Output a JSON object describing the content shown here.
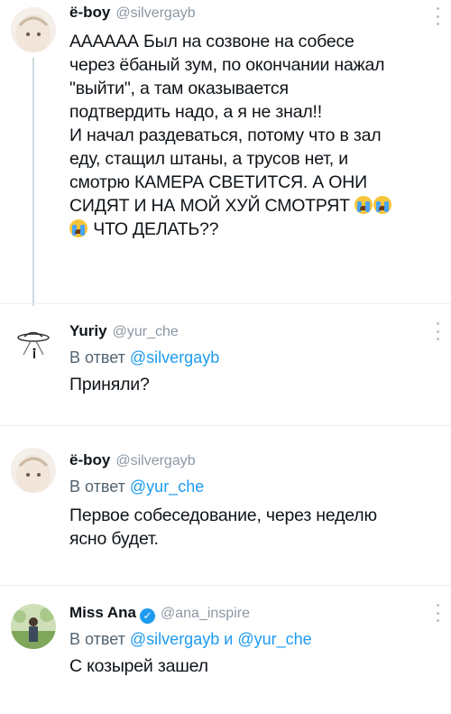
{
  "posts": [
    {
      "name": "ё-boy",
      "handle": "@silvergayb",
      "lines": [
        "АААААА Был на созвоне на собесе",
        "через ёбаный зум, по окончании нажал",
        "\"выйти\", а там оказывается",
        "подтвердить надо, а я не знал!!",
        "И начал раздеваться, потому что в зал",
        "еду, стащил штаны, а трусов нет, и",
        "смотрю КАМЕРА СВЕТИТСЯ. А ОНИ",
        "СИДЯТ И НА МОЙ ХУЙ СМОТРЯТ"
      ],
      "last_line": "ЧТО ДЕЛАТЬ??",
      "emoji": "loudly-crying-face"
    },
    {
      "name": "Yuriy",
      "handle": "@yur_che",
      "reply_prefix": "В ответ",
      "reply_to": "@silvergayb",
      "lines": [
        "Приняли?"
      ]
    },
    {
      "name": "ё-boy",
      "handle": "@silvergayb",
      "reply_prefix": "В ответ",
      "reply_to": "@yur_che",
      "lines": [
        "Первое собеседование, через неделю",
        "ясно будет."
      ]
    },
    {
      "name": "Miss Ana",
      "handle": "@ana_inspire",
      "reply_prefix": "В ответ",
      "reply_to": "@silvergayb",
      "reply_joiner": "и",
      "reply_to_2": "@yur_che",
      "lines": [
        "С козырей зашел"
      ]
    }
  ],
  "icons": {
    "more": "more-vertical-icon",
    "verified": "verified-badge-icon"
  },
  "colors": {
    "mention": "#1d9bf0",
    "secondary": "#536471",
    "verified": "#1d9bf0"
  }
}
